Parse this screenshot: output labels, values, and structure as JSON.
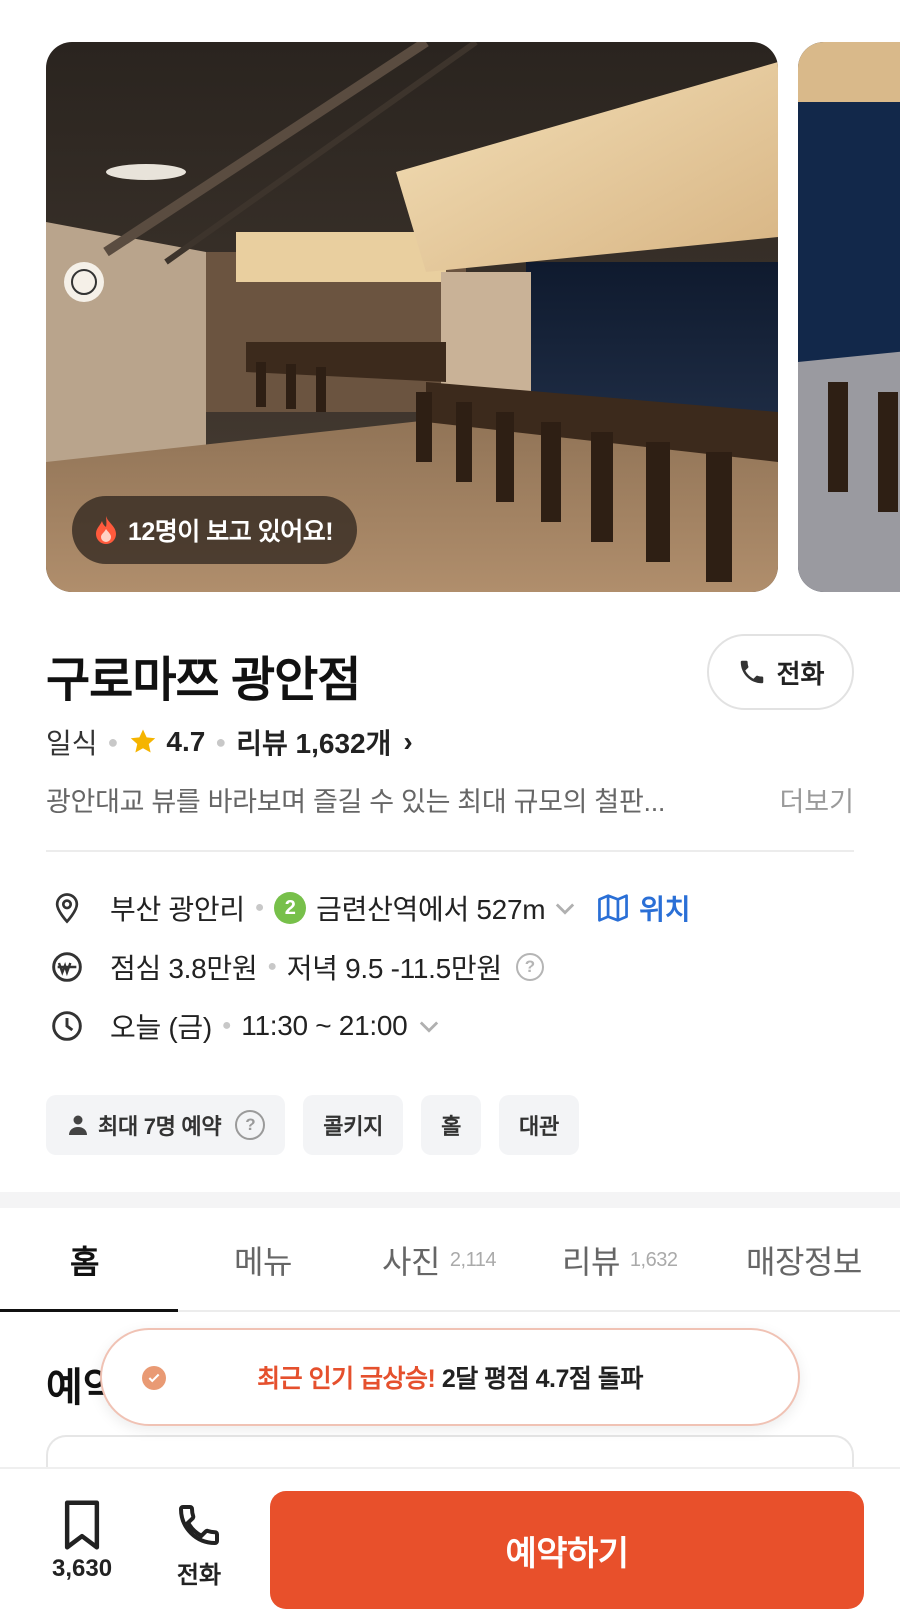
{
  "gallery": {
    "viewing_badge": "12명이 보고 있어요!"
  },
  "restaurant": {
    "name": "구로마쯔 광안점",
    "category": "일식",
    "rating": "4.7",
    "reviews_label": "리뷰 1,632개",
    "description": "광안대교 뷰를 바라보며 즐길 수 있는 최대 규모의 철판...",
    "more_label": "더보기",
    "call_label": "전화"
  },
  "info": {
    "location": "부산 광안리",
    "subway_line": "2",
    "subway_distance": "금련산역에서 527m",
    "map_link": "위치",
    "lunch_price": "점심 3.8만원",
    "dinner_price": "저녁 9.5 -11.5만원",
    "hours_day": "오늘 (금)",
    "hours_time": "11:30 ~ 21:00"
  },
  "tags": [
    {
      "label": "최대 7명 예약"
    },
    {
      "label": "콜키지"
    },
    {
      "label": "홀"
    },
    {
      "label": "대관"
    }
  ],
  "tabs": [
    {
      "label": "홈",
      "count": ""
    },
    {
      "label": "메뉴",
      "count": ""
    },
    {
      "label": "사진",
      "count": "2,114"
    },
    {
      "label": "리뷰",
      "count": "1,632"
    },
    {
      "label": "매장정보",
      "count": ""
    }
  ],
  "section": {
    "title": "예약"
  },
  "toast": {
    "highlight": "최근 인기 급상승!",
    "message": " 2달 평점 4.7점 돌파"
  },
  "bottom_bar": {
    "bookmark_count": "3,630",
    "call_label": "전화",
    "reserve_label": "예약하기"
  },
  "colors": {
    "accent": "#e8502b",
    "link": "#2a6fd6",
    "subway_line_2": "#77c04a",
    "star": "#f5b400"
  }
}
